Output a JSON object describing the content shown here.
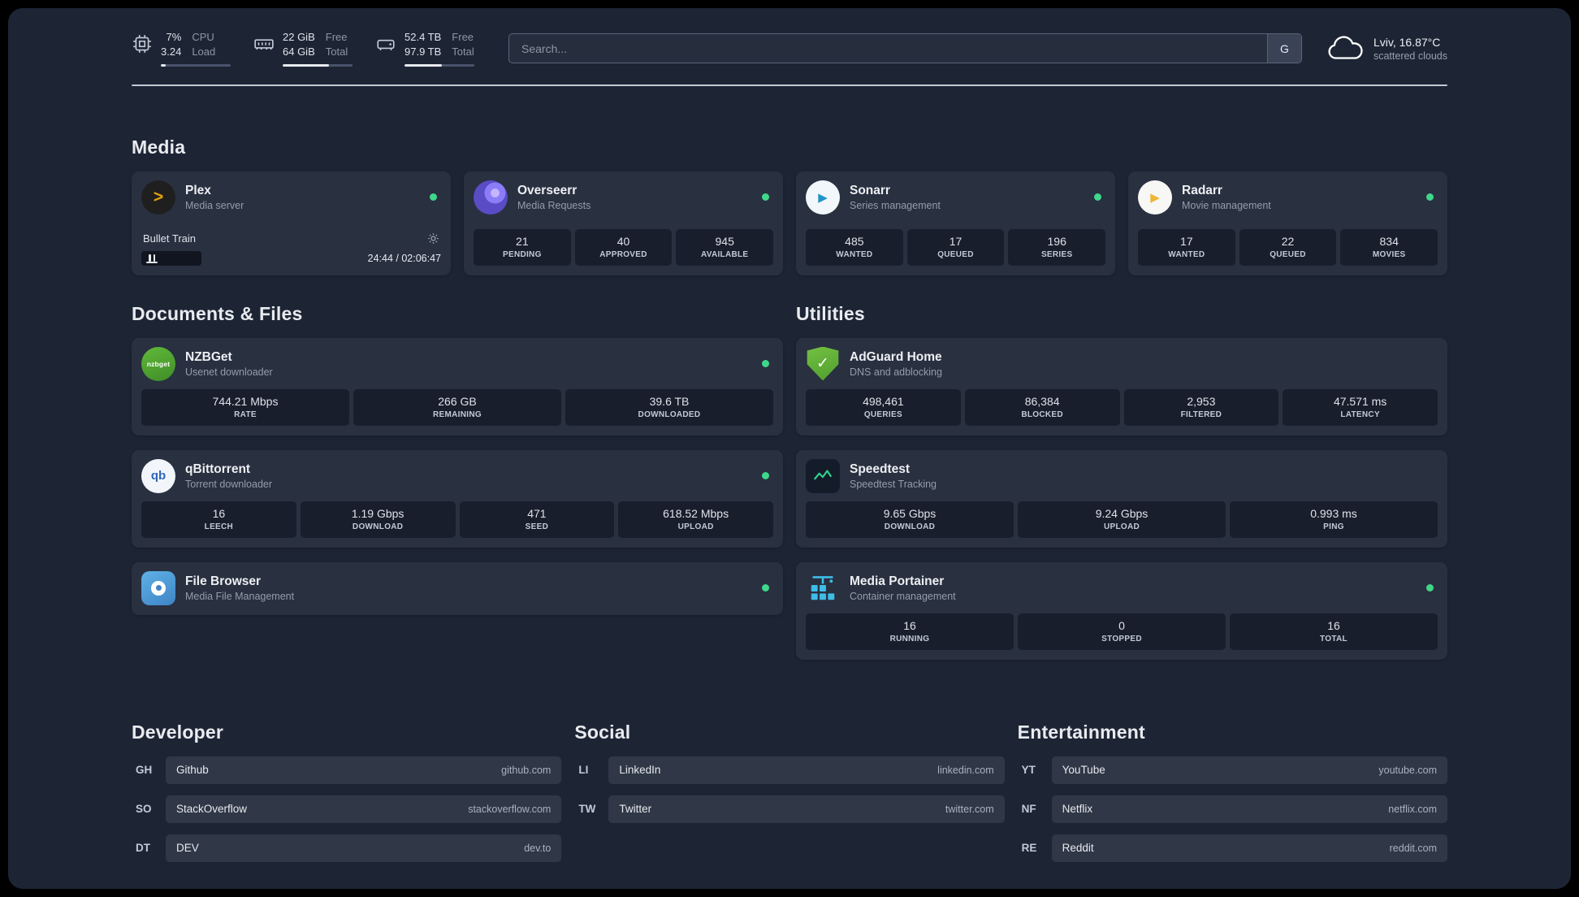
{
  "topbar": {
    "cpu": {
      "value_top": "7%",
      "value_bottom": "3.24",
      "label_top": "CPU",
      "label_bottom": "Load",
      "bar_percent": 7
    },
    "memory": {
      "value_top": "22 GiB",
      "value_bottom": "64 GiB",
      "label_top": "Free",
      "label_bottom": "Total",
      "bar_percent": 66
    },
    "storage": {
      "value_top": "52.4 TB",
      "value_bottom": "97.9 TB",
      "label_top": "Free",
      "label_bottom": "Total",
      "bar_percent": 54
    },
    "search": {
      "placeholder": "Search...",
      "button_label": "G"
    },
    "weather": {
      "location": "Lviv, 16.87°C",
      "description": "scattered clouds"
    }
  },
  "groups": {
    "media": {
      "title": "Media",
      "services": [
        {
          "name": "Plex",
          "desc": "Media server",
          "icon": "plex",
          "online": true,
          "player": {
            "title": "Bullet Train",
            "time": "24:44 / 02:06:47",
            "progress_percent": 19
          }
        },
        {
          "name": "Overseerr",
          "desc": "Media Requests",
          "icon": "overseerr",
          "online": true,
          "stats": [
            {
              "value": "21",
              "label": "PENDING"
            },
            {
              "value": "40",
              "label": "APPROVED"
            },
            {
              "value": "945",
              "label": "AVAILABLE"
            }
          ]
        },
        {
          "name": "Sonarr",
          "desc": "Series management",
          "icon": "sonarr",
          "online": true,
          "stats": [
            {
              "value": "485",
              "label": "WANTED"
            },
            {
              "value": "17",
              "label": "QUEUED"
            },
            {
              "value": "196",
              "label": "SERIES"
            }
          ]
        },
        {
          "name": "Radarr",
          "desc": "Movie management",
          "icon": "radarr",
          "online": true,
          "stats": [
            {
              "value": "17",
              "label": "WANTED"
            },
            {
              "value": "22",
              "label": "QUEUED"
            },
            {
              "value": "834",
              "label": "MOVIES"
            }
          ]
        }
      ]
    },
    "documents": {
      "title": "Documents & Files",
      "services": [
        {
          "name": "NZBGet",
          "desc": "Usenet downloader",
          "icon": "nzbget",
          "online": true,
          "stats": [
            {
              "value": "744.21 Mbps",
              "label": "RATE"
            },
            {
              "value": "266 GB",
              "label": "REMAINING"
            },
            {
              "value": "39.6 TB",
              "label": "DOWNLOADED"
            }
          ]
        },
        {
          "name": "qBittorrent",
          "desc": "Torrent downloader",
          "icon": "qbittorrent",
          "online": true,
          "stats": [
            {
              "value": "16",
              "label": "LEECH"
            },
            {
              "value": "1.19 Gbps",
              "label": "DOWNLOAD"
            },
            {
              "value": "471",
              "label": "SEED"
            },
            {
              "value": "618.52 Mbps",
              "label": "UPLOAD"
            }
          ]
        },
        {
          "name": "File Browser",
          "desc": "Media File Management",
          "icon": "filebrowser",
          "online": true
        }
      ]
    },
    "utilities": {
      "title": "Utilities",
      "services": [
        {
          "name": "AdGuard Home",
          "desc": "DNS and adblocking",
          "icon": "adguard",
          "online": false,
          "stats": [
            {
              "value": "498,461",
              "label": "QUERIES"
            },
            {
              "value": "86,384",
              "label": "BLOCKED"
            },
            {
              "value": "2,953",
              "label": "FILTERED"
            },
            {
              "value": "47.571 ms",
              "label": "LATENCY"
            }
          ]
        },
        {
          "name": "Speedtest",
          "desc": "Speedtest Tracking",
          "icon": "speedtest",
          "online": false,
          "stats": [
            {
              "value": "9.65 Gbps",
              "label": "DOWNLOAD"
            },
            {
              "value": "9.24 Gbps",
              "label": "UPLOAD"
            },
            {
              "value": "0.993 ms",
              "label": "PING"
            }
          ]
        },
        {
          "name": "Media Portainer",
          "desc": "Container management",
          "icon": "portainer",
          "online": true,
          "stats": [
            {
              "value": "16",
              "label": "RUNNING"
            },
            {
              "value": "0",
              "label": "STOPPED"
            },
            {
              "value": "16",
              "label": "TOTAL"
            }
          ]
        }
      ]
    }
  },
  "bookmark_groups": [
    {
      "title": "Developer",
      "bookmarks": [
        {
          "abbr": "GH",
          "name": "Github",
          "domain": "github.com"
        },
        {
          "abbr": "SO",
          "name": "StackOverflow",
          "domain": "stackoverflow.com"
        },
        {
          "abbr": "DT",
          "name": "DEV",
          "domain": "dev.to"
        }
      ]
    },
    {
      "title": "Social",
      "bookmarks": [
        {
          "abbr": "LI",
          "name": "LinkedIn",
          "domain": "linkedin.com"
        },
        {
          "abbr": "TW",
          "name": "Twitter",
          "domain": "twitter.com"
        }
      ]
    },
    {
      "title": "Entertainment",
      "bookmarks": [
        {
          "abbr": "YT",
          "name": "YouTube",
          "domain": "youtube.com"
        },
        {
          "abbr": "NF",
          "name": "Netflix",
          "domain": "netflix.com"
        },
        {
          "abbr": "RE",
          "name": "Reddit",
          "domain": "reddit.com"
        }
      ]
    }
  ],
  "colors": {
    "online_dot": "#3fd78a",
    "plex_amber": "#e5a00d",
    "overseerr_purple": "#5a4cc4",
    "sonarr_blue": "#2193c9",
    "radarr_amber": "#f0b437",
    "nzbget_green": "#54a931",
    "qbittorrent_blue": "#2f67ba",
    "filebrowser_blue": "#4a90d0",
    "adguard_green": "#68b730",
    "speedtest_green": "#2fd18c",
    "portainer_blue": "#3dbde8"
  }
}
